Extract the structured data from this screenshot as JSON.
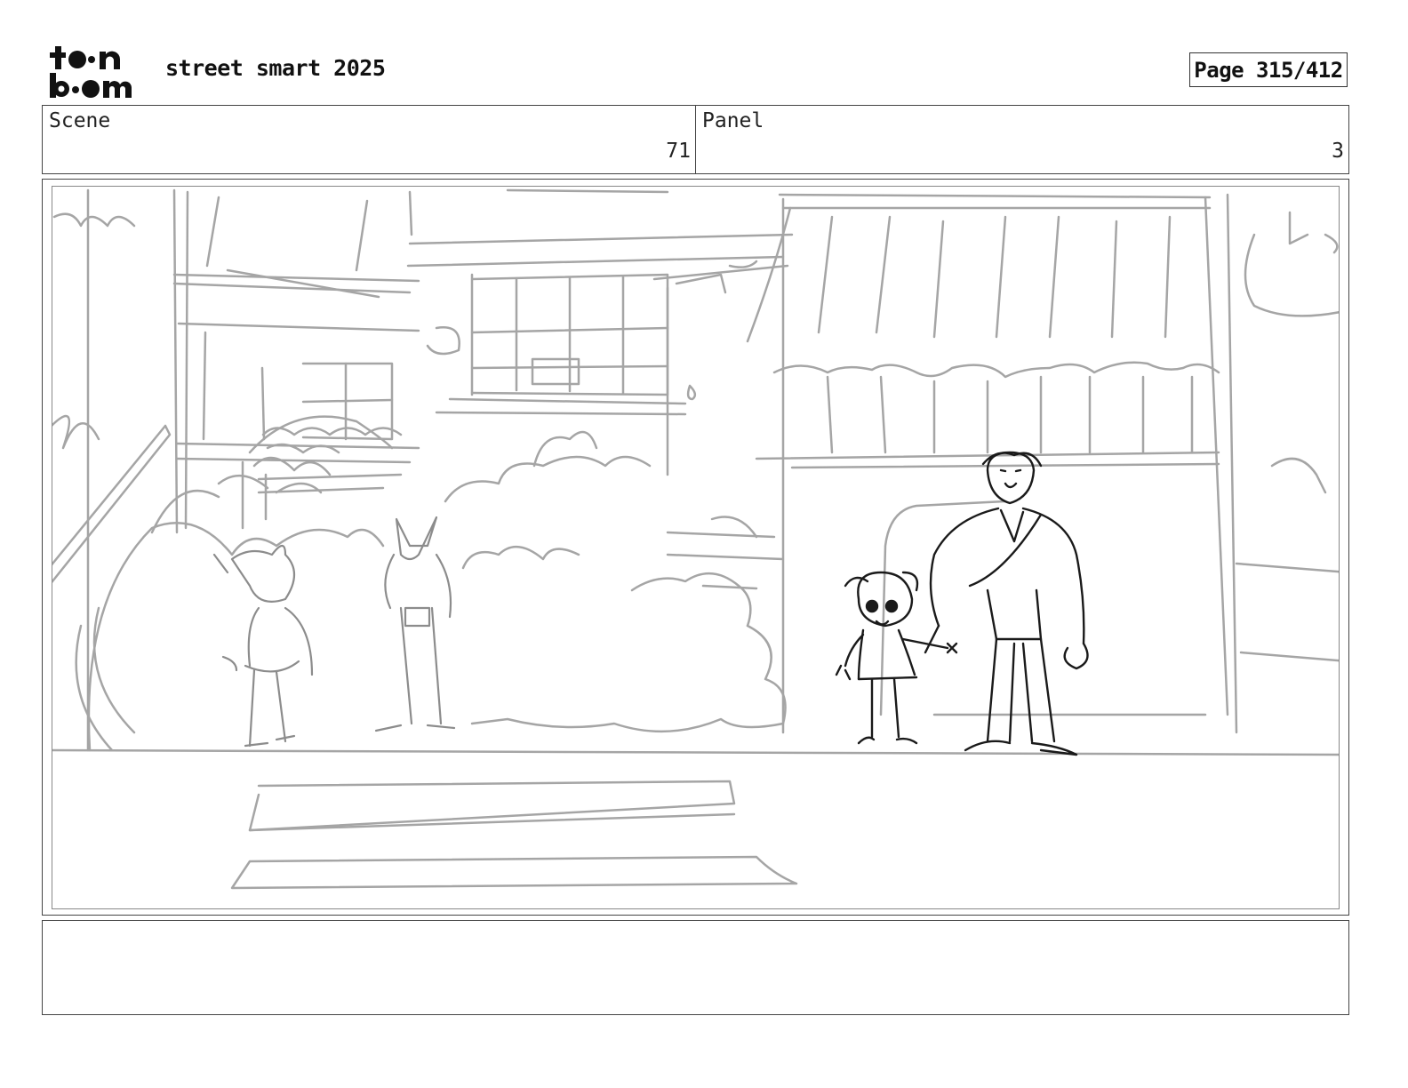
{
  "header": {
    "logo": {
      "icon": "toonboom-logo-icon",
      "text": "toon boom"
    },
    "title": "street smart 2025",
    "page_label": "Page 315/412"
  },
  "info": {
    "scene_label": "Scene",
    "scene_value": "71",
    "panel_label": "Panel",
    "panel_value": "3"
  },
  "colors": {
    "sketch_background": "#a5a5a5",
    "sketch_foreground": "#1a1a1a",
    "border": "#444444"
  }
}
